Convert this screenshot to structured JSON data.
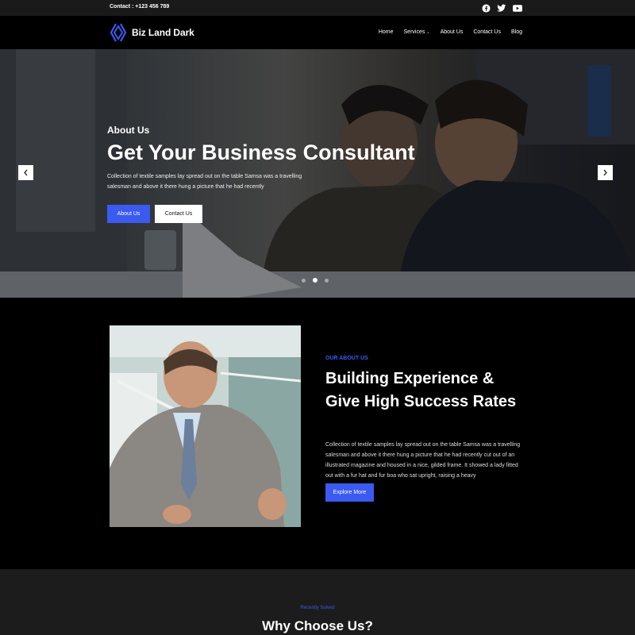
{
  "topbar": {
    "contact": "Contact : +123 456 789",
    "socials": [
      "facebook-icon",
      "twitter-icon",
      "youtube-icon"
    ]
  },
  "header": {
    "logo_text": "Biz Land Dark",
    "nav": [
      "Home",
      "Services",
      "About Us",
      "Contact Us",
      "Blog"
    ]
  },
  "hero": {
    "subtitle": "About Us",
    "title": "Get Your Business Consultant",
    "description": "Collection of textile samples lay spread out on the table Samsa was a travelling salesman and above it there hung a picture that he had recently",
    "primary_button": "About Us",
    "secondary_button": "Contact Us",
    "slides_total": 3,
    "active_slide": 2
  },
  "about": {
    "eyebrow": "OUR ABOUT US",
    "heading": "Building Experience & Give High Success Rates",
    "paragraph": "Collection of textile samples lay spread out on the table Samsa was a travelling salesman and above it there hung a picture that he had recently cut out of an illustrated magazine and housed in a nice, gilded frame. It showed a lady fitted out with a fur hat and fur boa who sat upright, raising a heavy",
    "button": "Explore More"
  },
  "why": {
    "eyebrow": "Recently Solved",
    "heading": "Why Choose Us?"
  },
  "colors": {
    "accent": "#3a5af0",
    "background": "#000000",
    "topbar": "#1a1a1a"
  }
}
